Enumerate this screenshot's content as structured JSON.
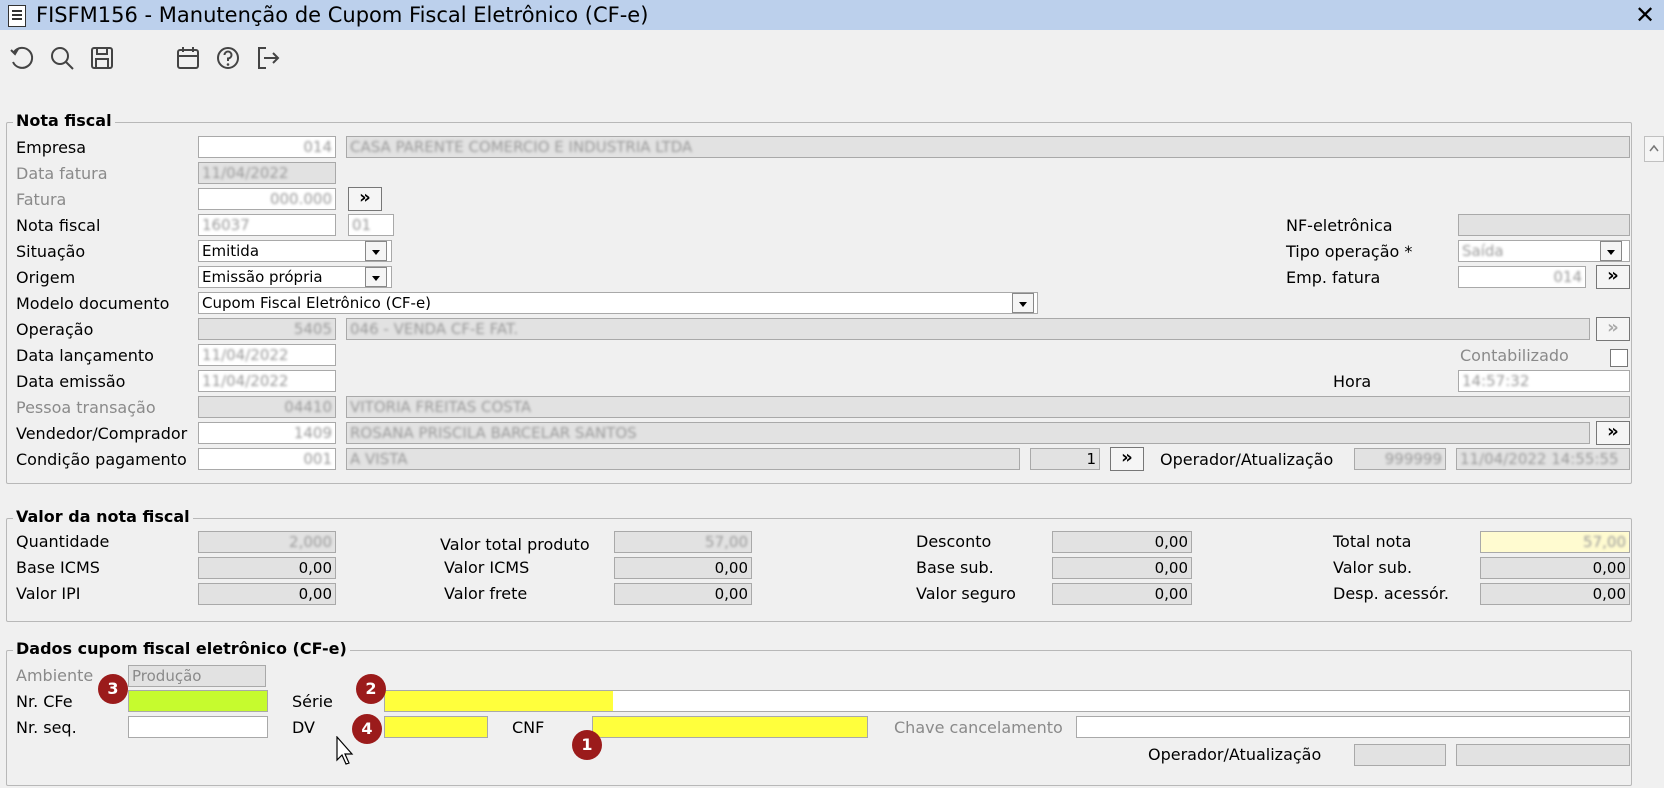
{
  "window": {
    "title": "FISFM156 - Manutenção de Cupom Fiscal Eletrônico (CF-e)",
    "close_label": "✕"
  },
  "toolbar": {
    "icons": [
      "undo-icon",
      "search-icon",
      "save-icon",
      "calendar-icon",
      "help-icon",
      "exit-icon"
    ]
  },
  "nota_fiscal": {
    "group_title": "Nota fiscal",
    "empresa_label": "Empresa",
    "empresa_code": "014",
    "empresa_name": "CASA PARENTE COMERCIO E INDUSTRIA LTDA",
    "data_fatura_label": "Data fatura",
    "data_fatura_value": "11/04/2022",
    "fatura_label": "Fatura",
    "fatura_value": "000.000",
    "fatura_btn": "»",
    "nota_fiscal_label": "Nota fiscal",
    "nota_fiscal_value": "16037",
    "nota_fiscal_serie": "01",
    "situacao_label": "Situação",
    "situacao_value": "Emitida",
    "origem_label": "Origem",
    "origem_value": "Emissão própria",
    "modelo_label": "Modelo documento",
    "modelo_value": "Cupom Fiscal Eletrônico (CF-e)",
    "operacao_label": "Operação",
    "operacao_code": "5405",
    "operacao_desc": "046 - VENDA CF-E FAT.",
    "data_lancamento_label": "Data lançamento",
    "data_lancamento_value": "11/04/2022",
    "data_emissao_label": "Data emissão",
    "data_emissao_value": "11/04/2022",
    "pessoa_label": "Pessoa transação",
    "pessoa_code": "04410",
    "pessoa_name": "VITORIA FREITAS COSTA",
    "vendedor_label": "Vendedor/Comprador",
    "vendedor_code": "1409",
    "vendedor_name": "ROSANA PRISCILA BARCELAR SANTOS",
    "vendedor_btn": "»",
    "condicao_label": "Condição pagamento",
    "condicao_code": "001",
    "condicao_desc": "A VISTA",
    "condicao_parcelas": "1",
    "condicao_btn": "»",
    "operador_label": "Operador/Atualização",
    "operador_value": "999999",
    "operador_data": "11/04/2022 14:55:55",
    "nfe_label": "NF-eletrônica",
    "nfe_value": "",
    "tipo_operacao_label": "Tipo operação *",
    "tipo_operacao_value": "Saída",
    "emp_fatura_label": "Emp. fatura",
    "emp_fatura_value": "014",
    "emp_fatura_btn": "»",
    "operacao_btn": "»",
    "contabilizado_label": "Contabilizado",
    "hora_label": "Hora",
    "hora_value": "14:57:32"
  },
  "valor_nota": {
    "group_title": "Valor da nota fiscal",
    "quantidade_label": "Quantidade",
    "quantidade_value": "2,000",
    "base_icms_label": "Base ICMS",
    "base_icms_value": "0,00",
    "valor_ipi_label": "Valor IPI",
    "valor_ipi_value": "0,00",
    "valor_total_produto_label": "Valor total produto",
    "valor_total_produto_value": "57,00",
    "valor_icms_label": "Valor ICMS",
    "valor_icms_value": "0,00",
    "valor_frete_label": "Valor frete",
    "valor_frete_value": "0,00",
    "desconto_label": "Desconto",
    "desconto_value": "0,00",
    "base_sub_label": "Base sub.",
    "base_sub_value": "0,00",
    "valor_seguro_label": "Valor seguro",
    "valor_seguro_value": "0,00",
    "total_nota_label": "Total nota",
    "total_nota_value": "57,00",
    "valor_sub_label": "Valor sub.",
    "valor_sub_value": "0,00",
    "desp_acessor_label": "Desp. acessór.",
    "desp_acessor_value": "0,00"
  },
  "cfe": {
    "group_title": "Dados cupom fiscal eletrônico (CF-e)",
    "ambiente_label": "Ambiente",
    "ambiente_value": "Produção",
    "nr_cfe_label": "Nr. CFe",
    "nr_cfe_value": "",
    "nr_seq_label": "Nr. seq.",
    "nr_seq_value": "",
    "serie_label": "Série",
    "serie_value": "",
    "dv_label": "DV",
    "dv_value": "",
    "cnf_label": "CNF",
    "cnf_value": "",
    "chave_cancelamento_label": "Chave cancelamento",
    "chave_cancelamento_value": "",
    "operador_label": "Operador/Atualização",
    "operador_value": "",
    "operador_data": ""
  },
  "badges": [
    "1",
    "2",
    "3",
    "4"
  ]
}
